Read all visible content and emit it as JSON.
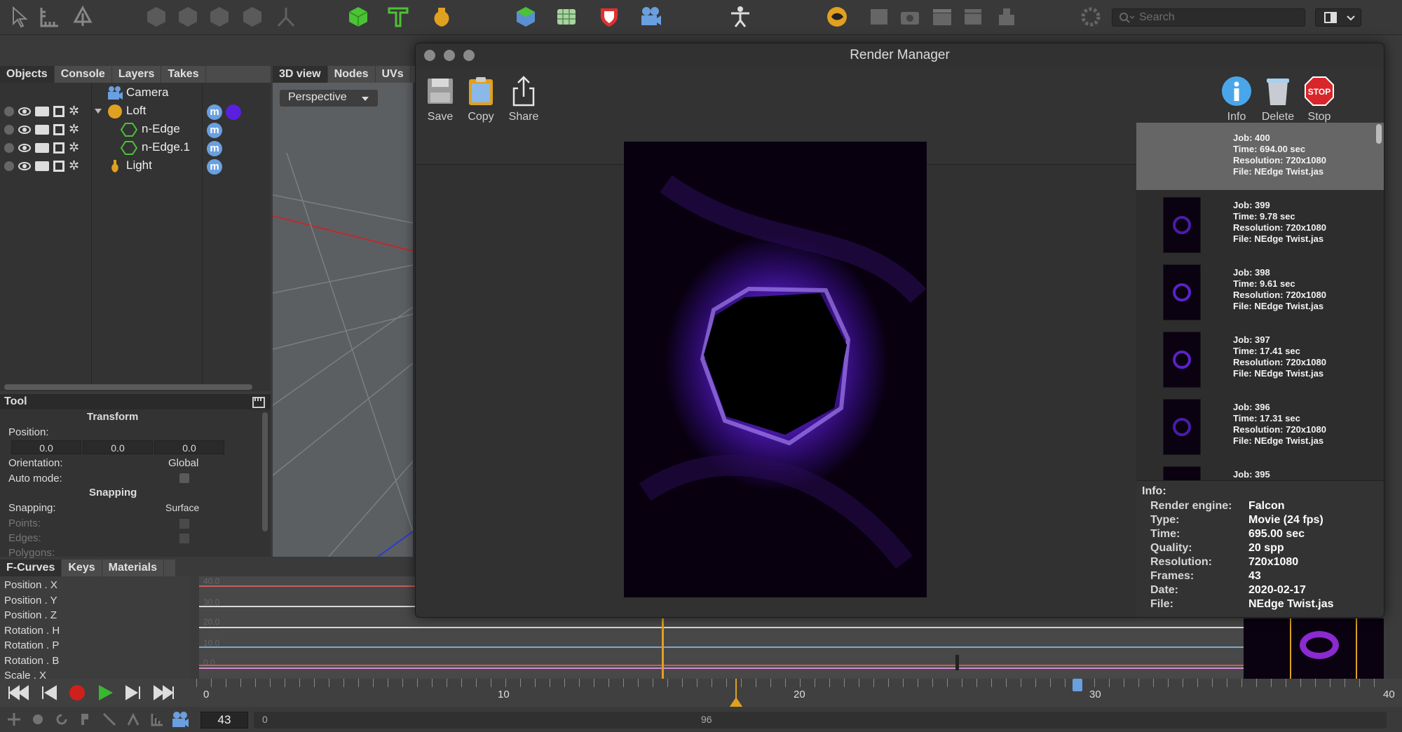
{
  "search": {
    "placeholder": "Search"
  },
  "left_tabs": [
    "Objects",
    "Console",
    "Layers",
    "Takes"
  ],
  "view_tabs": [
    "3D view",
    "Nodes",
    "UVs"
  ],
  "viewport": {
    "camera_mode": "Perspective"
  },
  "objects": [
    {
      "name": "Camera",
      "icon": "camera-icon"
    },
    {
      "name": "Loft",
      "icon": "loft-icon",
      "expanded": true
    },
    {
      "name": "n-Edge",
      "icon": "polygon-icon"
    },
    {
      "name": "n-Edge.1",
      "icon": "polygon-icon"
    },
    {
      "name": "Light",
      "icon": "light-icon"
    }
  ],
  "tool": {
    "title": "Tool",
    "transform_header": "Transform",
    "position_label": "Position:",
    "position": [
      "0.0",
      "0.0",
      "0.0"
    ],
    "orientation_label": "Orientation:",
    "orientation": "Global",
    "auto_mode_label": "Auto mode:",
    "snapping_header": "Snapping",
    "snapping_label": "Snapping:",
    "snapping": "Surface",
    "points_label": "Points:",
    "edges_label": "Edges:",
    "polygons_label": "Polygons:"
  },
  "bottom_tabs": [
    "F-Curves",
    "Keys",
    "Materials"
  ],
  "fcurves": [
    "Position . X",
    "Position . Y",
    "Position . Z",
    "Rotation . H",
    "Rotation . P",
    "Rotation . B",
    "Scale . X"
  ],
  "fcurve_grid": [
    "40.0",
    "30.0",
    "20.0",
    "10.0",
    "0.0"
  ],
  "timeline": {
    "ticks": [
      "0",
      "10",
      "20",
      "30",
      "40"
    ],
    "current_frame": "43",
    "range_start": "0",
    "range_end": "96"
  },
  "render_manager": {
    "title": "Render Manager",
    "tools": {
      "save": "Save",
      "copy": "Copy",
      "share": "Share",
      "info": "Info",
      "delete": "Delete",
      "stop": "Stop"
    },
    "stop_sign": "STOP",
    "jobs": [
      {
        "job": "Job: 400",
        "time": "Time: 694.00 sec",
        "resolution": "Resolution: 720x1080",
        "file": "File: NEdge Twist.jas"
      },
      {
        "job": "Job: 399",
        "time": "Time: 9.78 sec",
        "resolution": "Resolution: 720x1080",
        "file": "File: NEdge Twist.jas"
      },
      {
        "job": "Job: 398",
        "time": "Time: 9.61 sec",
        "resolution": "Resolution: 720x1080",
        "file": "File: NEdge Twist.jas"
      },
      {
        "job": "Job: 397",
        "time": "Time: 17.41 sec",
        "resolution": "Resolution: 720x1080",
        "file": "File: NEdge Twist.jas"
      },
      {
        "job": "Job: 396",
        "time": "Time: 17.31 sec",
        "resolution": "Resolution: 720x1080",
        "file": "File: NEdge Twist.jas"
      },
      {
        "job": "Job: 395"
      }
    ],
    "info": {
      "header": "Info:",
      "rows": [
        {
          "k": "Render engine:",
          "v": "Falcon"
        },
        {
          "k": "Type:",
          "v": "Movie (24 fps)"
        },
        {
          "k": "Time:",
          "v": "695.00 sec"
        },
        {
          "k": "Quality:",
          "v": "20 spp"
        },
        {
          "k": "Resolution:",
          "v": "720x1080"
        },
        {
          "k": "Frames:",
          "v": "43"
        },
        {
          "k": "Date:",
          "v": "2020-02-17"
        },
        {
          "k": "File:",
          "v": "NEdge Twist.jas"
        }
      ]
    }
  },
  "colors": {
    "accent": "#6a9fe0",
    "render_purple": "#6a2fd8",
    "record": "#d0201c",
    "play": "#38b830"
  }
}
